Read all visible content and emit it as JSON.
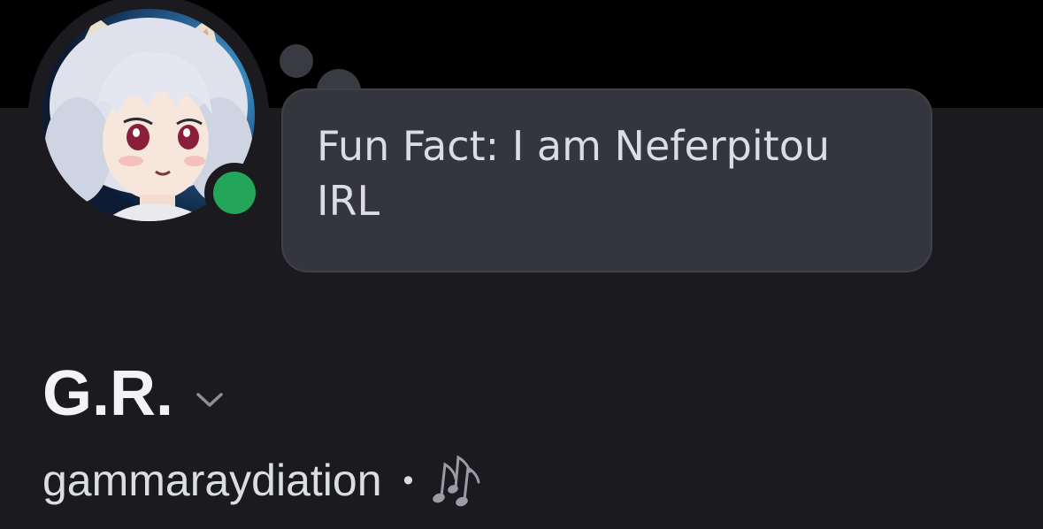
{
  "profile": {
    "display_name": "G.R.",
    "username": "gammaraydiation",
    "separator": "•",
    "custom_status": "Fun Fact: I am Neferpitou IRL",
    "presence": "online",
    "avatar_icon": "anime-avatar-icon",
    "activity_icon": "music-notes-icon"
  },
  "colors": {
    "background": "#1b1b1f",
    "banner": "#000000",
    "bubble": "#35363d",
    "online": "#23a55a"
  }
}
